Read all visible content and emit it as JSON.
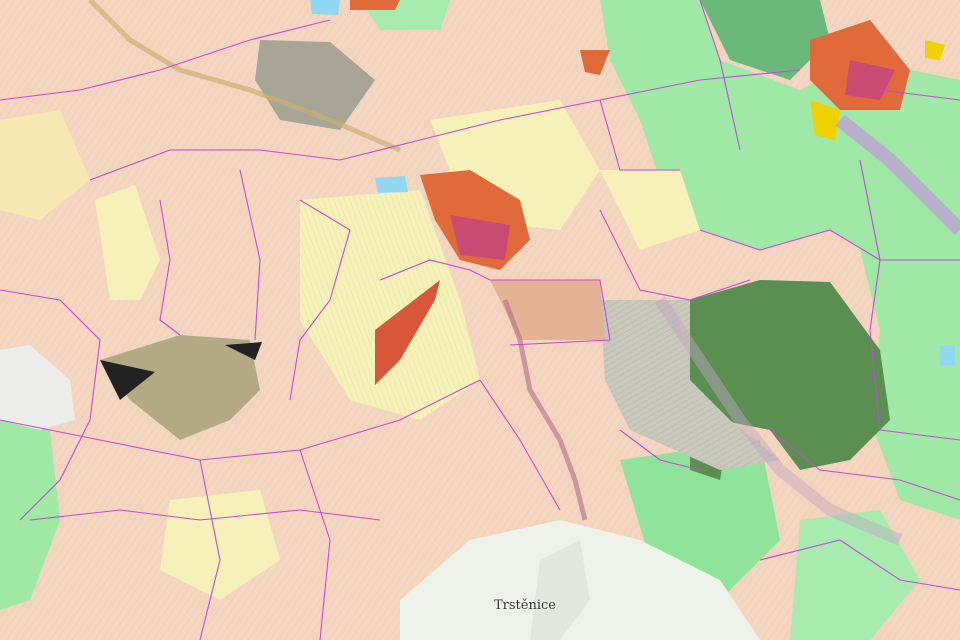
{
  "map": {
    "place_labels": [
      {
        "name": "Trstěnice"
      }
    ],
    "land_use_colors": {
      "arable_land": "#f4d6c0",
      "grassland": "#f6f1b8",
      "forest": "#9fe8a6",
      "dense_forest": "#5b8f52",
      "built_up": "#e06a3a",
      "water": "#8fd8ef",
      "boundary": "#c24ad6"
    }
  }
}
